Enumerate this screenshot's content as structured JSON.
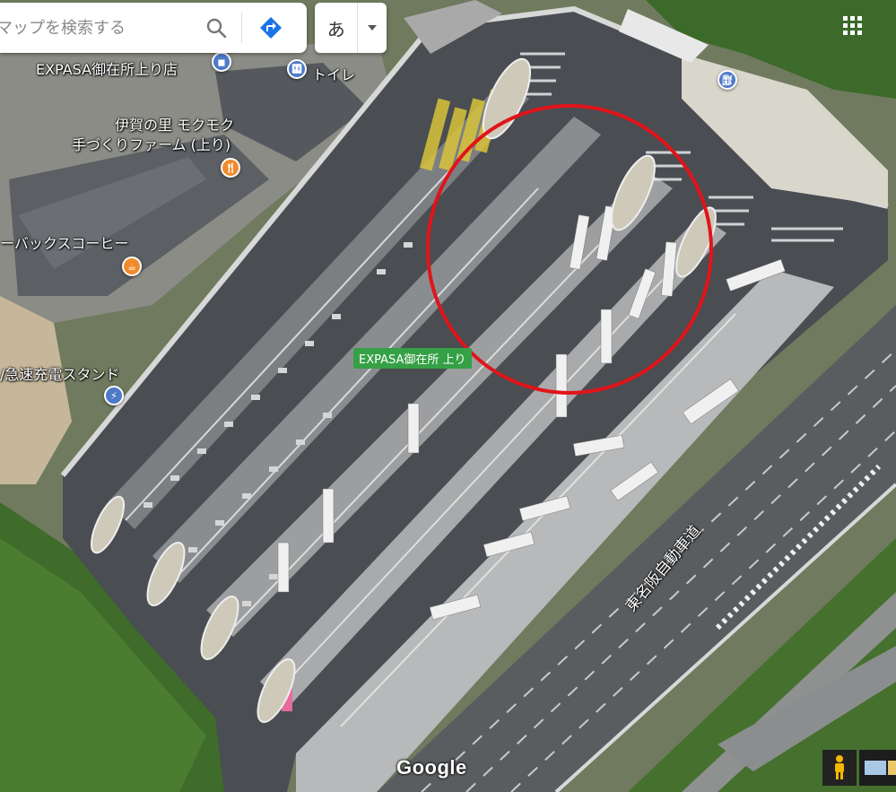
{
  "search": {
    "placeholder": "マップを検索する",
    "search_icon": "search-icon",
    "directions_icon": "directions-icon"
  },
  "ime": {
    "label": "あ",
    "dropdown_icon": "caret-down-icon"
  },
  "apps_icon": "apps-grid-icon",
  "map_labels": {
    "expasa_store": "EXPASA御在所上り店",
    "toilet": "トイレ",
    "farm_line1": "伊賀の里 モクモク",
    "farm_line2": "手づくりファーム (上り)",
    "coffee": "ーバックスコーヒー",
    "ev_charge": "/急速充電スタンド",
    "expasa_sa": "EXPASA御在所 上り",
    "expressway": "東名阪自動車道"
  },
  "branding": {
    "logo": "Google"
  },
  "colors": {
    "poi_blue": "#4e7ac7",
    "poi_orange": "#f08a2c",
    "highlight_circle": "#e0141a",
    "sa_label_bg": "#35a046",
    "directions_blue": "#1a73e8"
  }
}
